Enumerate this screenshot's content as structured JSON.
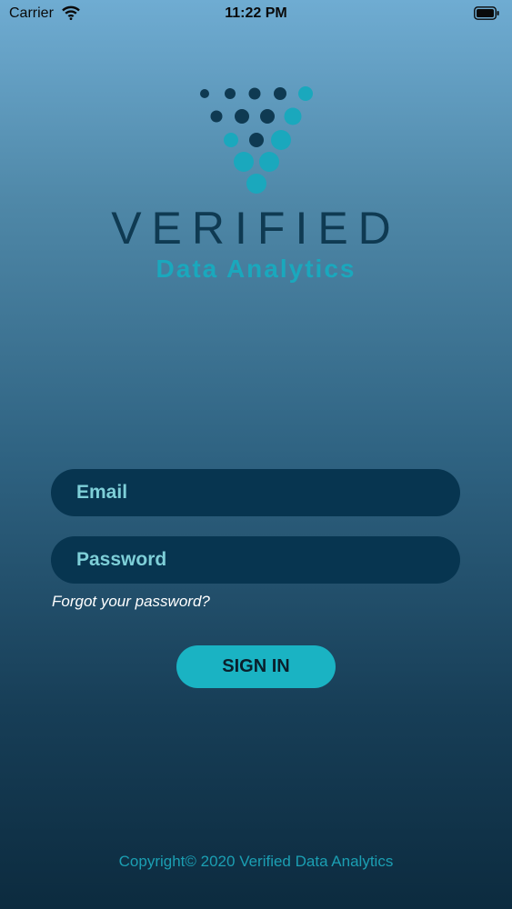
{
  "status_bar": {
    "carrier": "Carrier",
    "time": "11:22 PM",
    "wifi_icon": "wifi-icon",
    "battery_icon": "battery-icon"
  },
  "brand": {
    "name": "VERIFIED",
    "tagline": "Data Analytics",
    "logo_icon": "dot-triangle-logo",
    "colors": {
      "dark": "#0f3a52",
      "accent": "#1aa8bd"
    }
  },
  "form": {
    "email_placeholder": "Email",
    "password_placeholder": "Password",
    "forgot_label": "Forgot your password?",
    "signin_label": "SIGN IN"
  },
  "footer": {
    "copyright": "Copyright© 2020 Verified Data Analytics"
  }
}
